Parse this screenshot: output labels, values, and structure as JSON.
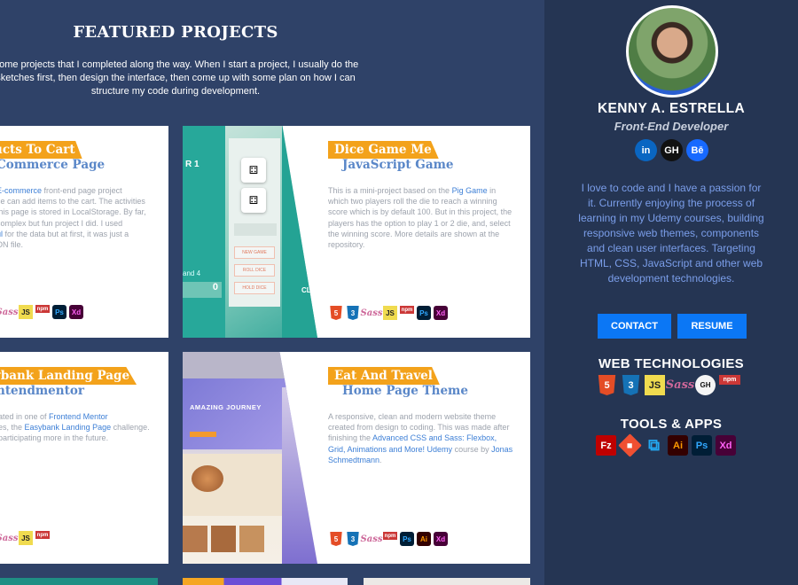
{
  "main": {
    "title": "FEATURED PROJECTS",
    "description": "Some projects that I completed along the way. When I start a project, I usually do the sketches first, then design the interface, then come up with some plan on how I can structure my code during development."
  },
  "projects": [
    {
      "tag": "ucts To Cart",
      "subtitle": "Commerce Page",
      "desc_parts": [
        "",
        "E-commerce",
        " front-end page project",
        "ce can add items to the cart. The activities",
        "this page is stored in LocalStorage. By far,",
        "complex but fun project I did. I used",
        "ul",
        " for the data but at first, it was just a",
        "ON file."
      ],
      "tech": [
        "Sass",
        "JS",
        "npm",
        "Ps",
        "Xd"
      ]
    },
    {
      "tag": "Dice Game Me",
      "subtitle": "JavaScript Game",
      "desc_pre": "This is a mini-project based on the ",
      "desc_link": "Pig Game",
      "desc_post": " in which two players roll the die to reach a winning score which is by default 100. But in this project, the players has the option to play 1 or 2 die, and, select the winning score. More details are shown at the repository.",
      "thumb_label": "R 1",
      "thumb_buttons": [
        "NEW GAME",
        "ROLL DICE",
        "HOLD DICE"
      ],
      "thumb_score": "0",
      "thumb_small": "and 4",
      "thumb_ck": "CL",
      "tech": [
        "5",
        "3",
        "Sass",
        "JS",
        "npm",
        "Ps",
        "Xd"
      ]
    },
    {
      "tag": "ybank Landing Page",
      "subtitle": "ntendmentor",
      "desc_l1_pre": "ated in one of ",
      "desc_l1_link": "Frontend Mentor",
      "desc_l2_pre": "es, the ",
      "desc_l2_link": "Easybank Landing Page",
      "desc_l2_post": " challenge.",
      "desc_l3": "participating more in the future.",
      "tech": [
        "Sass",
        "JS",
        "npm"
      ]
    },
    {
      "tag": "Eat And Travel",
      "subtitle": "Home Page Theme",
      "desc_pre": "A responsive, clean and modern website theme created from design to coding. This was made after finishing the ",
      "desc_link": "Advanced CSS and Sass: Flexbox, Grid, Animations and More! Udemy",
      "desc_mid": " course by ",
      "desc_link2": "Jonas Schmedtmann",
      "desc_post": ".",
      "thumb_heading": "AMAZING JOURNEY",
      "tech": [
        "5",
        "3",
        "Sass",
        "npm",
        "Ps",
        "Ai",
        "Xd"
      ]
    }
  ],
  "profile": {
    "name": "KENNY A. ESTRELLA",
    "role": "Front-End Developer",
    "socials": [
      "in",
      "GH",
      "Bē"
    ],
    "about": "I love to code and I have a passion for it. Currently enjoying the process of learning in my Udemy courses, building responsive web themes, components and clean user interfaces. Targeting HTML, CSS, JavaScript and other web development technologies.",
    "contact_label": "CONTACT",
    "resume_label": "RESUME"
  },
  "web_tech": {
    "title": "WEB TECHNOLOGIES",
    "icons": [
      "5",
      "3",
      "JS",
      "Sass",
      "GH",
      "npm"
    ]
  },
  "tools": {
    "title": "TOOLS & APPS",
    "icons": [
      "Fz",
      "◆",
      "⧉",
      "Ai",
      "Ps",
      "Xd"
    ]
  },
  "colors": {
    "main_bg": "#2f4268",
    "sidebar_bg": "#253553",
    "accent_tag": "#f3a21b",
    "subtitle_blue": "#5a87c8",
    "button_blue": "#0b77f5"
  }
}
